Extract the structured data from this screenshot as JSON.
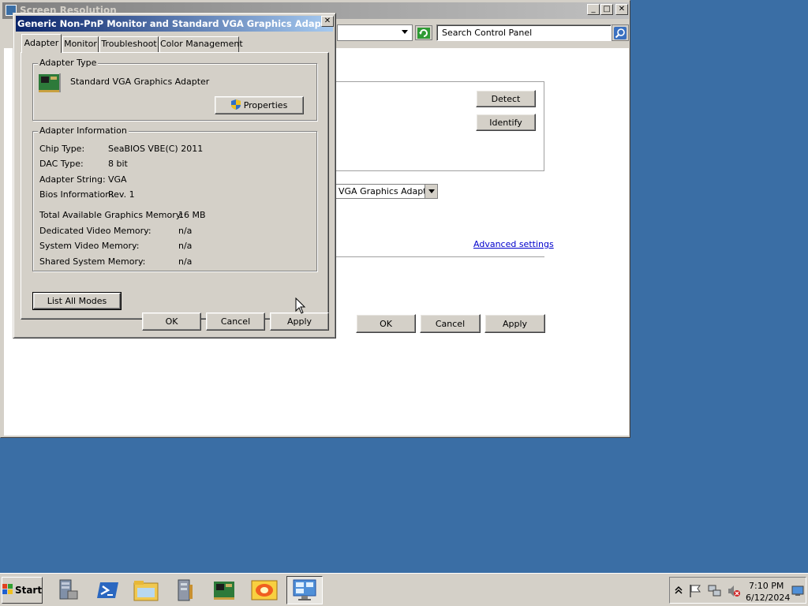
{
  "background_window": {
    "title": "Screen Resolution",
    "search": {
      "placeholder": "Search Control Panel"
    },
    "detect_label": "Detect",
    "identify_label": "Identify",
    "display_select_value": "VGA Graphics Adapter",
    "advanced_link": "Advanced settings",
    "ok_label": "OK",
    "cancel_label": "Cancel",
    "apply_label": "Apply",
    "min_glyph": "_",
    "max_glyph": "□",
    "close_glyph": "✕"
  },
  "dialog": {
    "title": "Generic Non-PnP Monitor and Standard VGA Graphics Adapter Pro...",
    "close_glyph": "✕",
    "tabs": [
      {
        "label": "Adapter",
        "active": true
      },
      {
        "label": "Monitor",
        "active": false
      },
      {
        "label": "Troubleshoot",
        "active": false
      },
      {
        "label": "Color Management",
        "active": false
      }
    ],
    "adapter_type": {
      "group_title": "Adapter Type",
      "name": "Standard VGA Graphics Adapter",
      "properties_label": "Properties"
    },
    "adapter_info": {
      "group_title": "Adapter Information",
      "rows": [
        {
          "label": "Chip Type:",
          "value": "SeaBIOS VBE(C) 2011"
        },
        {
          "label": "DAC Type:",
          "value": "8 bit"
        },
        {
          "label": "Adapter String:",
          "value": "VGA"
        },
        {
          "label": "Bios Information:",
          "value": "Rev. 1"
        }
      ],
      "memory_rows": [
        {
          "label": "Total Available Graphics Memory:",
          "value": "16 MB"
        },
        {
          "label": "Dedicated Video Memory:",
          "value": "n/a"
        },
        {
          "label": "System Video Memory:",
          "value": "n/a"
        },
        {
          "label": "Shared System Memory:",
          "value": "n/a"
        }
      ]
    },
    "list_all_modes_label": "List All Modes",
    "ok_label": "OK",
    "cancel_label": "Cancel",
    "apply_label": "Apply"
  },
  "taskbar": {
    "start_label": "Start",
    "icons": [
      "server-manager-icon",
      "powershell-icon",
      "explorer-icon",
      "admin-tools-icon",
      "display-adapter-icon",
      "media-icon",
      "screen-resolution-icon"
    ],
    "clock_time": "7:10 PM",
    "clock_date": "6/12/2024"
  },
  "colors": {
    "desktop": "#3a6ea5",
    "dialog_title_start": "#0a246a",
    "dialog_title_end": "#a6caf0",
    "link": "#0000cc"
  }
}
